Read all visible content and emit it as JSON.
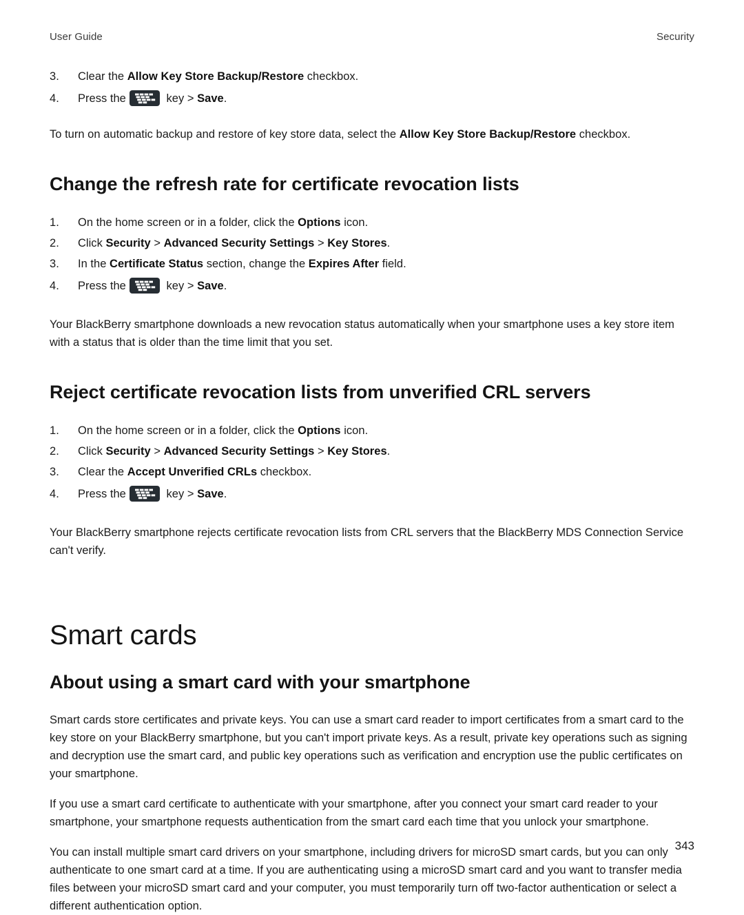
{
  "running_head": {
    "left": "User Guide",
    "right": "Security"
  },
  "icons": {
    "menu_key": "blackberry-menu-key-icon"
  },
  "continued_steps": {
    "items": [
      {
        "num": "3.",
        "runs": [
          {
            "t": "Clear the ",
            "b": false
          },
          {
            "t": "Allow Key Store Backup/Restore",
            "b": true
          },
          {
            "t": " checkbox.",
            "b": false
          }
        ]
      },
      {
        "num": "4.",
        "key": true,
        "pre": "Press the",
        "runs": [
          {
            "t": " key > ",
            "b": false
          },
          {
            "t": "Save",
            "b": true
          },
          {
            "t": ".",
            "b": false
          }
        ]
      }
    ]
  },
  "intro_note": {
    "runs": [
      {
        "t": "To turn on automatic backup and restore of key store data, select the ",
        "b": false
      },
      {
        "t": "Allow Key Store Backup/Restore",
        "b": true
      },
      {
        "t": " checkbox.",
        "b": false
      }
    ]
  },
  "sections": [
    {
      "id": "refresh-rate",
      "title": "Change the refresh rate for certificate revocation lists",
      "steps": [
        {
          "num": "1.",
          "runs": [
            {
              "t": "On the home screen or in a folder, click the ",
              "b": false
            },
            {
              "t": "Options",
              "b": true
            },
            {
              "t": " icon.",
              "b": false
            }
          ]
        },
        {
          "num": "2.",
          "runs": [
            {
              "t": "Click ",
              "b": false
            },
            {
              "t": "Security",
              "b": true
            },
            {
              "t": " > ",
              "b": false
            },
            {
              "t": "Advanced Security Settings",
              "b": true
            },
            {
              "t": " > ",
              "b": false
            },
            {
              "t": "Key Stores",
              "b": true
            },
            {
              "t": ".",
              "b": false
            }
          ]
        },
        {
          "num": "3.",
          "runs": [
            {
              "t": "In the ",
              "b": false
            },
            {
              "t": "Certificate Status",
              "b": true
            },
            {
              "t": " section, change the ",
              "b": false
            },
            {
              "t": "Expires After",
              "b": true
            },
            {
              "t": " field.",
              "b": false
            }
          ]
        },
        {
          "num": "4.",
          "key": true,
          "pre": "Press the",
          "runs": [
            {
              "t": " key > ",
              "b": false
            },
            {
              "t": "Save",
              "b": true
            },
            {
              "t": ".",
              "b": false
            }
          ]
        }
      ],
      "after": "Your BlackBerry smartphone downloads a new revocation status automatically when your smartphone uses a key store item with a status that is older than the time limit that you set."
    },
    {
      "id": "reject-crl",
      "title": "Reject certificate revocation lists from unverified CRL servers",
      "steps": [
        {
          "num": "1.",
          "runs": [
            {
              "t": "On the home screen or in a folder, click the ",
              "b": false
            },
            {
              "t": "Options",
              "b": true
            },
            {
              "t": " icon.",
              "b": false
            }
          ]
        },
        {
          "num": "2.",
          "runs": [
            {
              "t": "Click ",
              "b": false
            },
            {
              "t": "Security",
              "b": true
            },
            {
              "t": " > ",
              "b": false
            },
            {
              "t": "Advanced Security Settings",
              "b": true
            },
            {
              "t": " > ",
              "b": false
            },
            {
              "t": "Key Stores",
              "b": true
            },
            {
              "t": ".",
              "b": false
            }
          ]
        },
        {
          "num": "3.",
          "runs": [
            {
              "t": "Clear the ",
              "b": false
            },
            {
              "t": "Accept Unverified CRLs",
              "b": true
            },
            {
              "t": " checkbox.",
              "b": false
            }
          ]
        },
        {
          "num": "4.",
          "key": true,
          "pre": "Press the",
          "runs": [
            {
              "t": " key > ",
              "b": false
            },
            {
              "t": "Save",
              "b": true
            },
            {
              "t": ".",
              "b": false
            }
          ]
        }
      ],
      "after": "Your BlackBerry smartphone rejects certificate revocation lists from CRL servers that the BlackBerry MDS Connection Service can't verify."
    }
  ],
  "chapter": {
    "title": "Smart cards",
    "subsection_title": "About using a smart card with your smartphone",
    "paragraphs": [
      "Smart cards store certificates and private keys. You can use a smart card reader to import certificates from a smart card to the key store on your BlackBerry smartphone, but you can't import private keys. As a result, private key operations such as signing and decryption use the smart card, and public key operations such as verification and encryption use the public certificates on your smartphone.",
      "If you use a smart card certificate to authenticate with your smartphone, after you connect your smart card reader to your smartphone, your smartphone requests authentication from the smart card each time that you unlock your smartphone.",
      "You can install multiple smart card drivers on your smartphone, including drivers for microSD smart cards, but you can only authenticate to one smart card at a time. If you are authenticating using a microSD smart card and you want to transfer media files between your microSD smart card and your computer, you must temporarily turn off two-factor authentication or select a different authentication option."
    ]
  },
  "folio": {
    "page_number": "343"
  }
}
